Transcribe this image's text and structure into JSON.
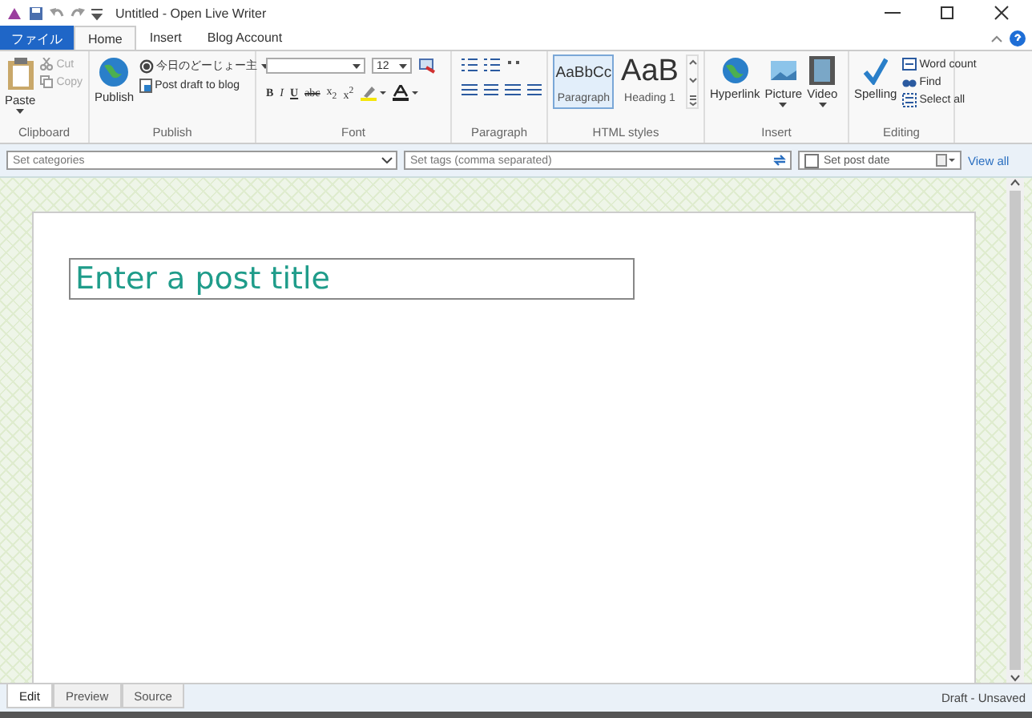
{
  "window": {
    "title": "Untitled - Open Live Writer"
  },
  "ribbon_tabs": [
    {
      "label": "ファイル",
      "kind": "file",
      "selected": false
    },
    {
      "label": "Home",
      "kind": "tab",
      "selected": true
    },
    {
      "label": "Insert",
      "kind": "tab",
      "selected": false
    },
    {
      "label": "Blog Account",
      "kind": "tab",
      "selected": false
    }
  ],
  "clipboard": {
    "paste": "Paste",
    "cut": {
      "label": "Cut",
      "disabled": true
    },
    "copy": {
      "label": "Copy",
      "disabled": true
    },
    "group": "Clipboard"
  },
  "publish": {
    "publish": "Publish",
    "blog": "今日のどーじょー主",
    "post_draft": "Post draft to blog",
    "group": "Publish"
  },
  "font": {
    "size": "12",
    "buttons": [
      "B",
      "I",
      "U",
      "abc",
      "x$_{2}$",
      "x$^{2}$"
    ],
    "group": "Font"
  },
  "paragraph": {
    "group": "Paragraph"
  },
  "html_styles": {
    "styles": [
      {
        "preview": "AaBbCc",
        "label": "Paragraph",
        "kind": "paragraph",
        "selected": true
      },
      {
        "preview": "AaB",
        "label": "Heading 1",
        "kind": "heading",
        "selected": false
      }
    ],
    "group": "HTML styles"
  },
  "insert": {
    "items": [
      "Hyperlink",
      "Picture",
      "Video"
    ],
    "group": "Insert"
  },
  "editing": {
    "spelling": "Spelling",
    "word_count": "Word count",
    "find": "Find",
    "select_all": "Select all",
    "group": "Editing"
  },
  "meta": {
    "categories_placeholder": "Set categories",
    "tags_placeholder": "Set tags (comma separated)",
    "post_date": {
      "label": "Set post date",
      "checked": false
    },
    "view_all": "View all"
  },
  "editor": {
    "title_placeholder": "Enter a post title"
  },
  "view_tabs": [
    {
      "label": "Edit",
      "selected": true
    },
    {
      "label": "Preview",
      "selected": false
    },
    {
      "label": "Source",
      "selected": false
    }
  ],
  "status": "Draft - Unsaved"
}
